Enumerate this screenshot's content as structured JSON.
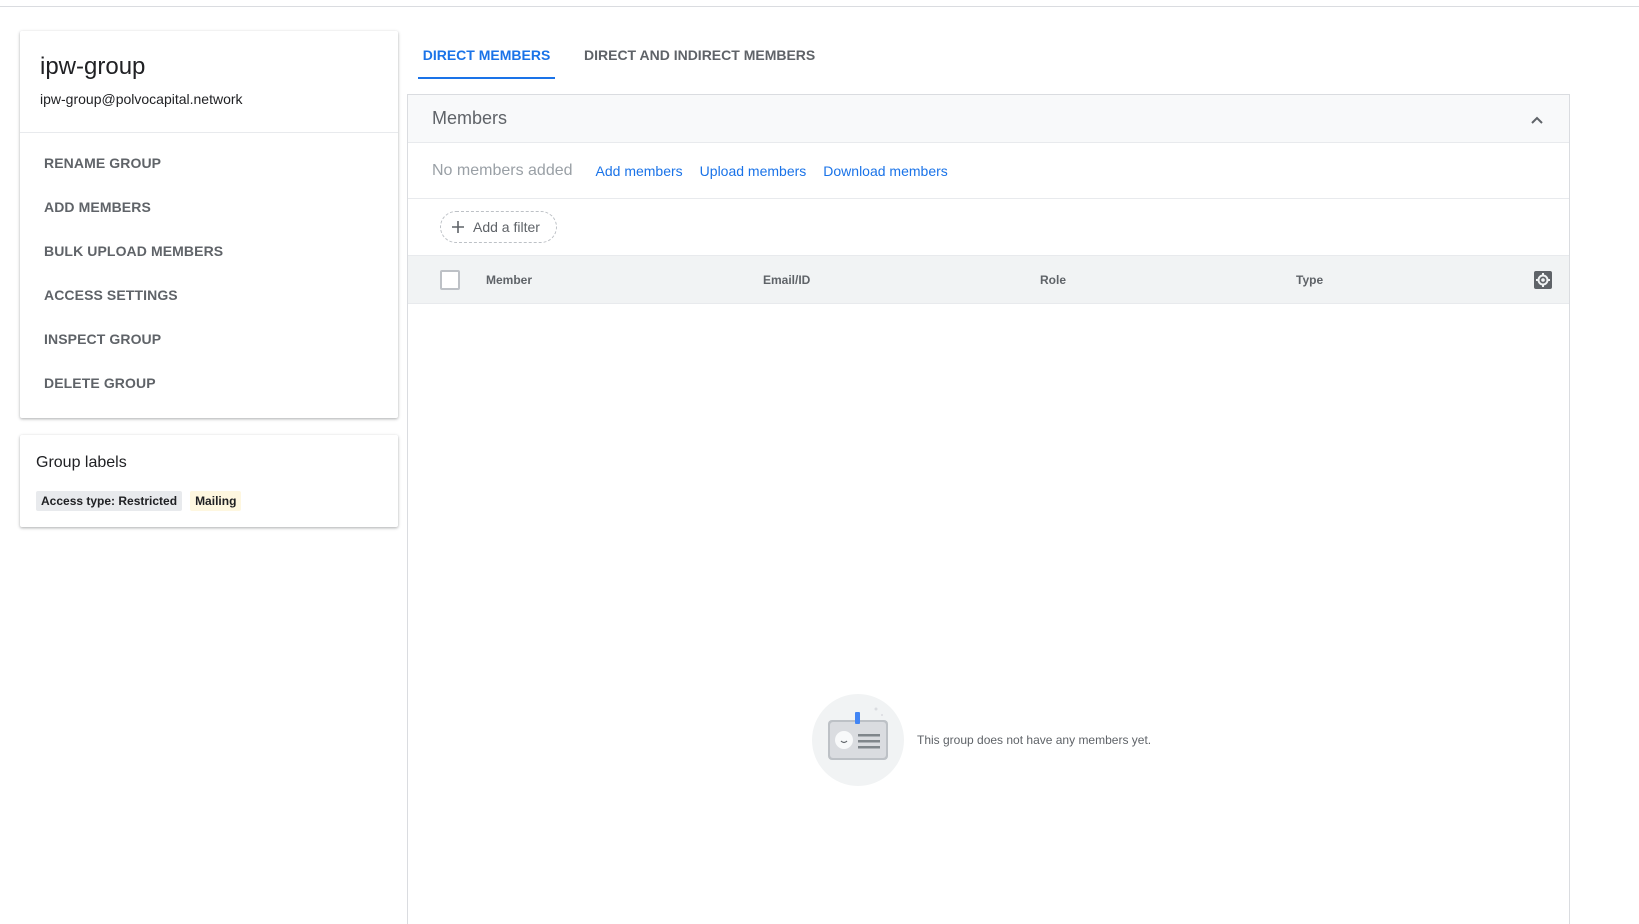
{
  "group": {
    "name": "ipw-group",
    "email": "ipw-group@polvocapital.network"
  },
  "actions": [
    {
      "label": "RENAME GROUP"
    },
    {
      "label": "ADD MEMBERS"
    },
    {
      "label": "BULK UPLOAD MEMBERS"
    },
    {
      "label": "ACCESS SETTINGS"
    },
    {
      "label": "INSPECT GROUP"
    },
    {
      "label": "DELETE GROUP"
    }
  ],
  "labels": {
    "title": "Group labels",
    "chips": [
      "Access type: Restricted",
      "Mailing"
    ]
  },
  "tabs": {
    "direct": "DIRECT MEMBERS",
    "indirect": "DIRECT AND INDIRECT MEMBERS",
    "active": "direct"
  },
  "members": {
    "title": "Members",
    "status": "No members added",
    "links": {
      "add": "Add members",
      "upload": "Upload members",
      "download": "Download members"
    },
    "filter_label": "Add a filter",
    "columns": {
      "member": "Member",
      "email": "Email/ID",
      "role": "Role",
      "type": "Type"
    },
    "empty_message": "This group does not have any members yet."
  },
  "icons": {
    "collapse": "chevron-up-icon",
    "filter": "plus-icon",
    "column_settings": "settings-icon",
    "empty": "empty-members-illustration"
  },
  "colors": {
    "accent": "#1a73e8",
    "text_secondary": "#5f6368",
    "chip_gray": "#e8eaed",
    "chip_yellow": "#fef7e0"
  }
}
